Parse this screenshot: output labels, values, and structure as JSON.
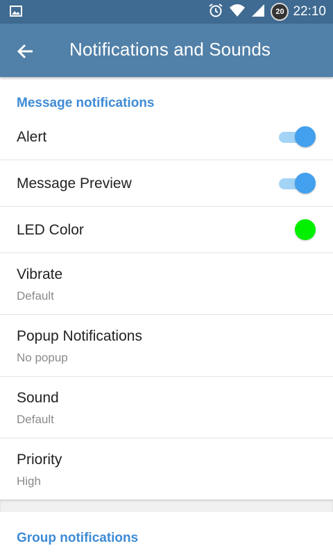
{
  "status_bar": {
    "left_icon": "image-icon",
    "icons": [
      "alarm-icon",
      "wifi-icon",
      "signal-icon",
      "battery-icon"
    ],
    "battery_level": "20",
    "time": "22:10"
  },
  "app_bar": {
    "back_icon": "arrow-back-icon",
    "title": "Notifications and Sounds",
    "background": "#5180a8"
  },
  "message_notifications": {
    "header": "Message notifications",
    "alert": {
      "label": "Alert",
      "enabled": true
    },
    "preview": {
      "label": "Message Preview",
      "enabled": true
    },
    "led": {
      "label": "LED Color",
      "color": "#00f000"
    },
    "vibrate": {
      "label": "Vibrate",
      "value": "Default"
    },
    "popup": {
      "label": "Popup Notifications",
      "value": "No popup"
    },
    "sound": {
      "label": "Sound",
      "value": "Default"
    },
    "priority": {
      "label": "Priority",
      "value": "High"
    }
  },
  "group_notifications": {
    "header": "Group notifications"
  },
  "colors": {
    "accent": "#3e8bd5",
    "toggle_on": "#42a0ee",
    "toggle_track": "#a4d4f5"
  }
}
